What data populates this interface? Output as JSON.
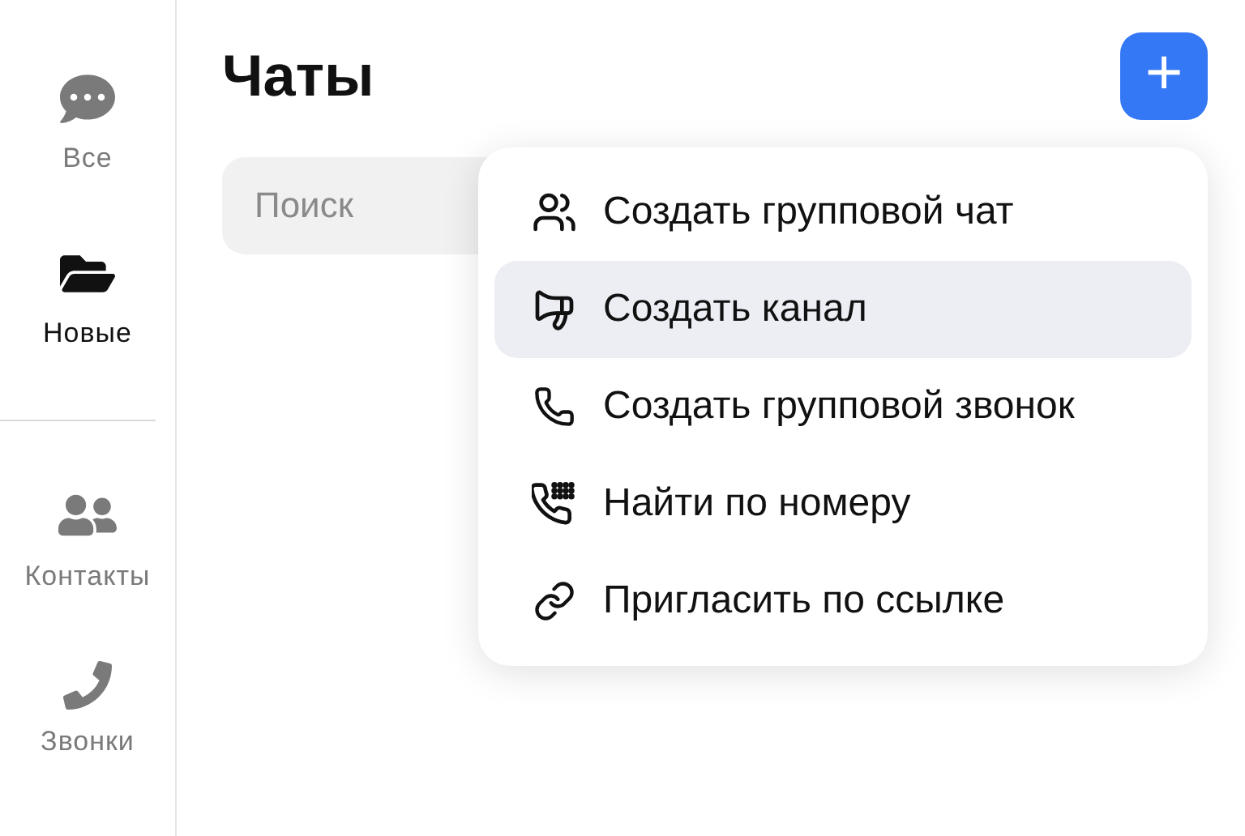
{
  "sidebar": {
    "items": [
      {
        "label": "Все",
        "selected": false
      },
      {
        "label": "Новые",
        "selected": true
      },
      {
        "kind": "divider"
      },
      {
        "label": "Контакты",
        "selected": false
      },
      {
        "label": "Звонки",
        "selected": false
      }
    ]
  },
  "header": {
    "title": "Чаты",
    "add_button": "+"
  },
  "search": {
    "placeholder": "Поиск"
  },
  "menu": {
    "items": [
      {
        "label": "Создать групповой чат",
        "selected": false
      },
      {
        "label": "Создать канал",
        "selected": true
      },
      {
        "label": "Создать групповой звонок",
        "selected": false
      },
      {
        "label": "Найти по номеру",
        "selected": false
      },
      {
        "label": "Пригласить по ссылке",
        "selected": false
      }
    ]
  }
}
